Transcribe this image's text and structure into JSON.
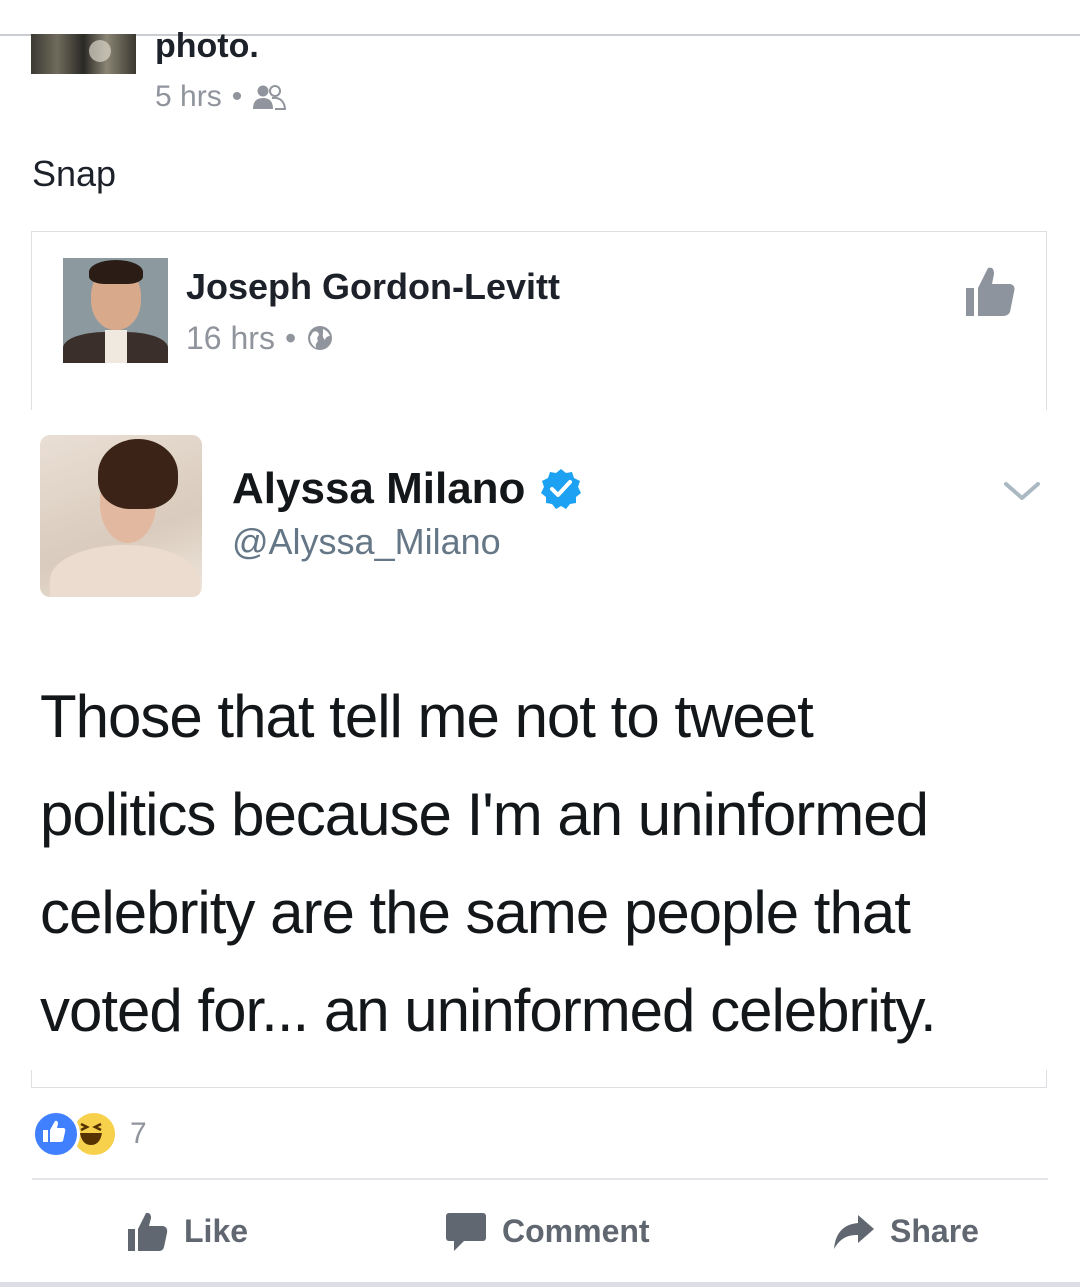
{
  "post": {
    "title_fragment": "photo.",
    "time": "5 hrs",
    "separator": "•",
    "privacy_icon": "friends-icon",
    "text": "Snap"
  },
  "shared_post": {
    "author": "Joseph Gordon-Levitt",
    "time": "16 hrs",
    "separator": "•",
    "privacy_icon": "globe-icon",
    "like_icon": "thumbs-up-icon"
  },
  "tweet": {
    "name": "Alyssa Milano",
    "handle": "@Alyssa_Milano",
    "verified_color": "#1da1f2",
    "lines": [
      "Those that tell me not to tweet",
      "politics because I'm an uninformed",
      "celebrity are the same people that",
      "voted for... an uninformed celebrity."
    ]
  },
  "reactions": {
    "types": [
      "like",
      "haha"
    ],
    "count": "7"
  },
  "actions": {
    "like": "Like",
    "comment": "Comment",
    "share": "Share"
  },
  "colors": {
    "meta_gray": "#90949c",
    "action_gray": "#606770",
    "like_blue": "#4080ff",
    "haha_yellow": "#f7d04c"
  }
}
